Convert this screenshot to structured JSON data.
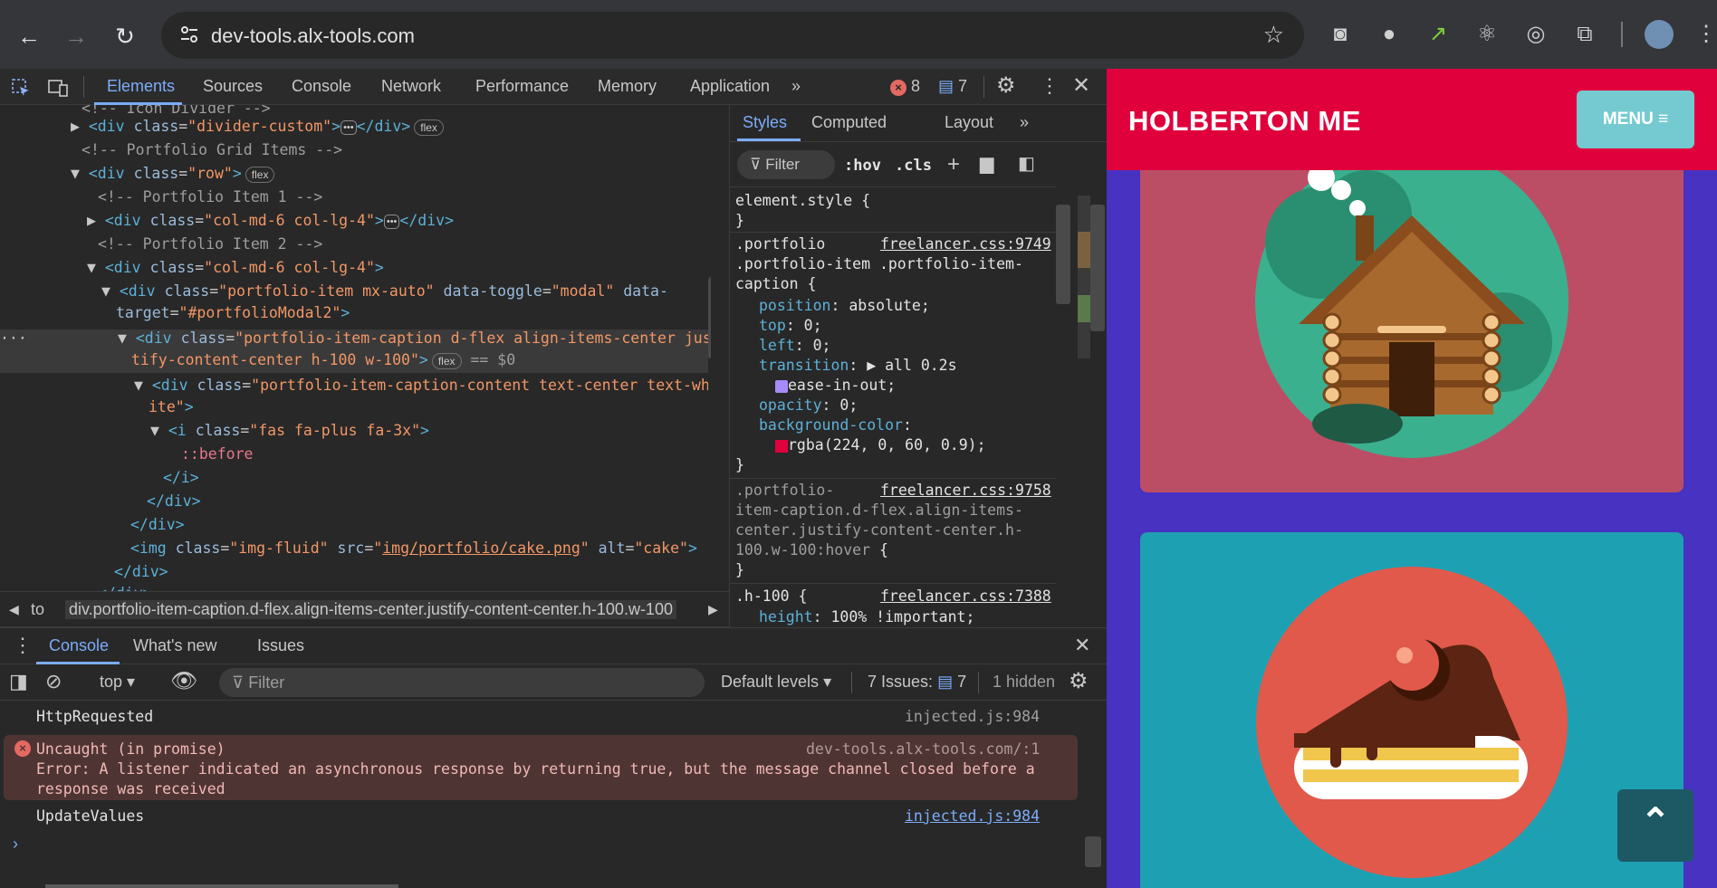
{
  "browser": {
    "url": "dev-tools.alx-tools.com"
  },
  "devtools": {
    "tabs": [
      "Elements",
      "Sources",
      "Console",
      "Network",
      "Performance",
      "Memory",
      "Application"
    ],
    "errors_count": "8",
    "messages_count": "7",
    "elements_lines": [
      "<!-- Icon Divider -->",
      "flex",
      "<!-- Portfolio Grid Items -->",
      "flex",
      "<!-- Portfolio Item 1 -->",
      "<!-- Portfolio Item 2 -->",
      "== $0",
      "::before",
      "img/portfolio/cake.png"
    ],
    "breadcrumb": [
      "to",
      "div.portfolio-item-caption.d-flex.align-items-center.justify-content-center.h-100.w-100"
    ],
    "styles_tabs": [
      "Styles",
      "Computed",
      "Layout"
    ],
    "styles_filter": "Filter",
    "styles_hov": ":hov",
    "styles_cls": ".cls",
    "rules": {
      "element_style": "element.style {",
      "src1": "freelancer.css:9749",
      "src2": "freelancer.css:9758",
      "src3": "freelancer.css:7388"
    },
    "console": {
      "tabs": [
        "Console",
        "What's new",
        "Issues"
      ],
      "context": "top",
      "filter_placeholder": "Filter",
      "levels": "Default levels",
      "issues": "7 Issues:",
      "issues_count": "7",
      "hidden": "1 hidden",
      "messages": [
        {
          "text": "HttpRequested",
          "source": "injected.js:984"
        },
        {
          "text": "Uncaught (in promise)",
          "source": "dev-tools.alx-tools.com/:1",
          "detail": "Error: A listener indicated an asynchronous response by returning true, but the message channel closed before a",
          "detail2": "response was received"
        },
        {
          "text": "UpdateValues",
          "source": "injected.js:984"
        }
      ]
    }
  },
  "page": {
    "brand": "HOLBERTON ME",
    "menu": "MENU ≡",
    "to_top": "⌃"
  }
}
